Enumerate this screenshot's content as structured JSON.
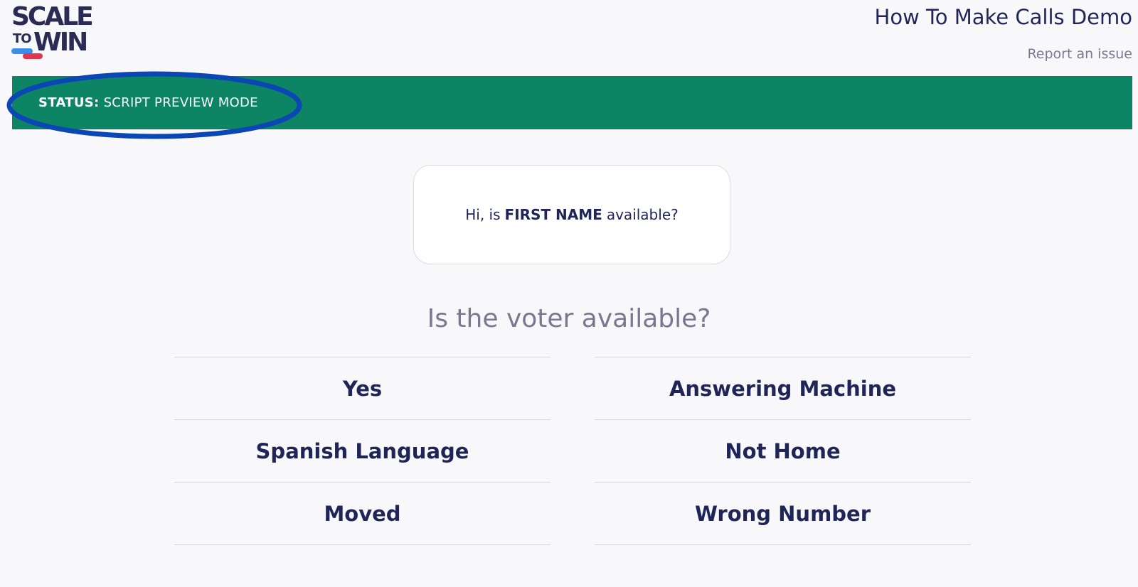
{
  "logo": {
    "line1": "SCALE",
    "to": "TO",
    "win": "WIN"
  },
  "header": {
    "title": "How To Make Calls Demo",
    "report_link": "Report an issue"
  },
  "status": {
    "label": "STATUS:",
    "value": "SCRIPT PREVIEW MODE"
  },
  "script": {
    "prefix": "Hi, is",
    "placeholder": "FIRST NAME",
    "suffix": "available?"
  },
  "question": "Is the voter available?",
  "answers": {
    "left": [
      "Yes",
      "Spanish Language",
      "Moved"
    ],
    "right": [
      "Answering Machine",
      "Not Home",
      "Wrong Number"
    ]
  },
  "colors": {
    "status_bar": "#0d8564",
    "highlight_ellipse": "#0a47b5",
    "navy_text": "#1f2556",
    "muted_text": "#7a7791"
  }
}
